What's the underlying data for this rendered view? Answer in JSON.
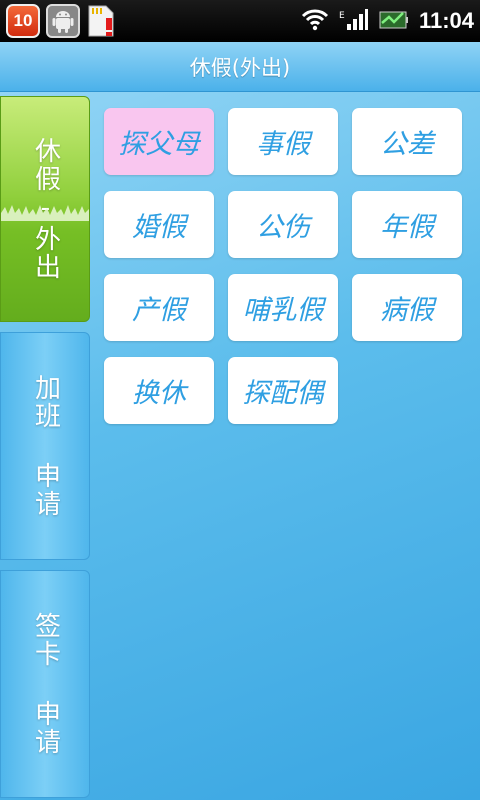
{
  "status_bar": {
    "notification_count": "10",
    "time": "11:04",
    "icons": [
      "wifi-icon",
      "signal-icon",
      "battery-charging-icon"
    ]
  },
  "header": {
    "title": "休假(外出)"
  },
  "sidebar": {
    "tabs": [
      {
        "label": "休假-外出",
        "active": true
      },
      {
        "label": "加班 申请",
        "active": false
      },
      {
        "label": "签卡 申请",
        "active": false
      }
    ]
  },
  "leave_types": [
    {
      "label": "探父母",
      "selected": true
    },
    {
      "label": "事假",
      "selected": false
    },
    {
      "label": "公差",
      "selected": false
    },
    {
      "label": "婚假",
      "selected": false
    },
    {
      "label": "公伤",
      "selected": false
    },
    {
      "label": "年假",
      "selected": false
    },
    {
      "label": "产假",
      "selected": false
    },
    {
      "label": "哺乳假",
      "selected": false
    },
    {
      "label": "病假",
      "selected": false
    },
    {
      "label": "换休",
      "selected": false
    },
    {
      "label": "探配偶",
      "selected": false
    }
  ],
  "colors": {
    "accent": "#2f9fe2",
    "selected_tile": "#f9c6ef",
    "active_tab": "#76bf25"
  }
}
